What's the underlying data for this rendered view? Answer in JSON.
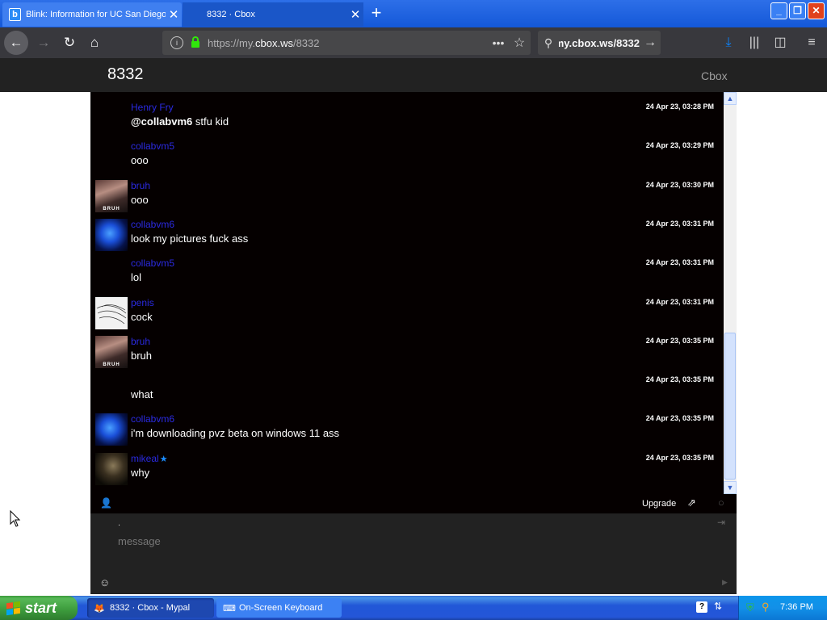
{
  "browser": {
    "tabs": [
      {
        "favicon": "b",
        "title": "Blink: Information for UC San Diego"
      },
      {
        "title": "8332 · Cbox"
      }
    ],
    "url_prefix": "https://my.",
    "url_domain": "cbox.ws",
    "url_path": "/8332",
    "search_text": "my.cbox.ws/8332"
  },
  "page": {
    "title": "8332",
    "brand": "Cbox"
  },
  "messages": [
    {
      "user": "Henry Fry",
      "mention": "@collabvm6",
      "text": " stfu kid",
      "time": "24 Apr 23, 03:28 PM",
      "avatar": "none"
    },
    {
      "user": "collabvm5",
      "mention": "",
      "text": "ooo",
      "time": "24 Apr 23, 03:29 PM",
      "avatar": "none"
    },
    {
      "user": "bruh",
      "mention": "",
      "text": "ooo",
      "time": "24 Apr 23, 03:30 PM",
      "avatar": "bruh"
    },
    {
      "user": "collabvm6",
      "mention": "",
      "text": "look my pictures fuck ass",
      "time": "24 Apr 23, 03:31 PM",
      "avatar": "collab"
    },
    {
      "user": "collabvm5",
      "mention": "",
      "text": "lol",
      "time": "24 Apr 23, 03:31 PM",
      "avatar": "none"
    },
    {
      "user": "penis",
      "mention": "",
      "text": "cock",
      "time": "24 Apr 23, 03:31 PM",
      "avatar": "penis"
    },
    {
      "user": "bruh",
      "mention": "",
      "text": "bruh",
      "time": "24 Apr 23, 03:35 PM",
      "avatar": "bruh"
    },
    {
      "user": "",
      "mention": "",
      "text": "what",
      "time": "24 Apr 23, 03:35 PM",
      "avatar": "none"
    },
    {
      "user": "collabvm6",
      "mention": "",
      "text": "i'm downloading pvz beta on windows 11 ass",
      "time": "24 Apr 23, 03:35 PM",
      "avatar": "collab"
    },
    {
      "user": "mikeal",
      "mention": "",
      "text": "why",
      "time": "24 Apr 23, 03:35 PM",
      "avatar": "mikeal",
      "badge": "★"
    }
  ],
  "avatar_label": "BRUH",
  "chat_toolbar": {
    "upgrade_label": "Upgrade"
  },
  "input": {
    "name_value": ".",
    "message_placeholder": "message"
  },
  "taskbar": {
    "start_label": "start",
    "tasks": [
      {
        "label": "8332 · Cbox - Mypal"
      },
      {
        "label": "On-Screen Keyboard"
      }
    ],
    "clock": "7:36 PM"
  },
  "icons": {
    "back": "arrow-left-icon",
    "forward": "arrow-right-icon",
    "reload": "reload-icon",
    "home": "home-icon",
    "download": "download-icon",
    "library": "library-icon",
    "sidebar": "sidebar-icon",
    "menu": "hamburger-icon"
  },
  "colors": {
    "username": "#2a2ae0",
    "chat_bg": "#050000",
    "header_bg": "#222222",
    "taskbar": "#2456d8",
    "start_button": "#3c9a3c"
  }
}
